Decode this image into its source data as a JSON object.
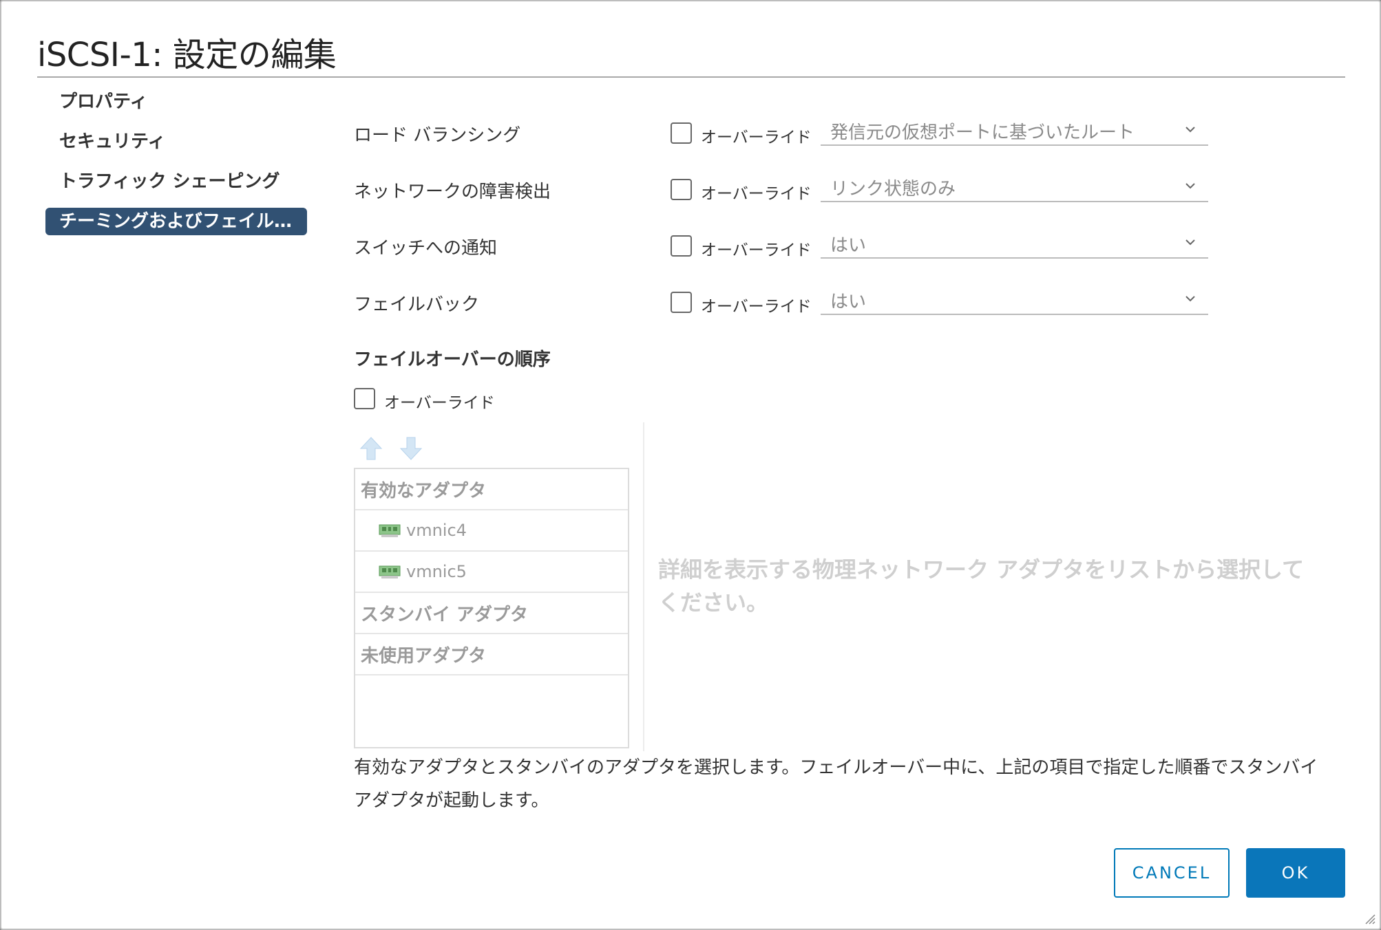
{
  "dialog": {
    "title": "iSCSI-1: 設定の編集"
  },
  "nav": {
    "items": [
      {
        "label": "プロパティ",
        "active": false
      },
      {
        "label": "セキュリティ",
        "active": false
      },
      {
        "label": "トラフィック シェーピング",
        "active": false
      },
      {
        "label": "チーミングおよびフェイルオーバー",
        "active": true
      }
    ]
  },
  "settings": [
    {
      "label": "ロード バランシング",
      "override_label": "オーバーライド",
      "override_checked": false,
      "value": "発信元の仮想ポートに基づいたルート"
    },
    {
      "label": "ネットワークの障害検出",
      "override_label": "オーバーライド",
      "override_checked": false,
      "value": "リンク状態のみ"
    },
    {
      "label": "スイッチへの通知",
      "override_label": "オーバーライド",
      "override_checked": false,
      "value": "はい"
    },
    {
      "label": "フェイルバック",
      "override_label": "オーバーライド",
      "override_checked": false,
      "value": "はい"
    }
  ],
  "failover": {
    "title": "フェイルオーバーの順序",
    "override_label": "オーバーライド",
    "override_checked": false,
    "list": {
      "active_header": "有効なアダプタ",
      "active_adapters": [
        "vmnic4",
        "vmnic5"
      ],
      "standby_header": "スタンバイ アダプタ",
      "unused_header": "未使用アダプタ"
    },
    "placeholder": "詳細を表示する物理ネットワーク アダプタをリストから選択してください。",
    "help_text": "有効なアダプタとスタンバイのアダプタを選択します。フェイルオーバー中に、上記の項目で指定した順番でスタンバイアダプタが起動します。"
  },
  "buttons": {
    "cancel_label": "CANCEL",
    "ok_label": "OK"
  },
  "colors": {
    "accent": "#0a76ba",
    "nav_active": "#315173"
  }
}
